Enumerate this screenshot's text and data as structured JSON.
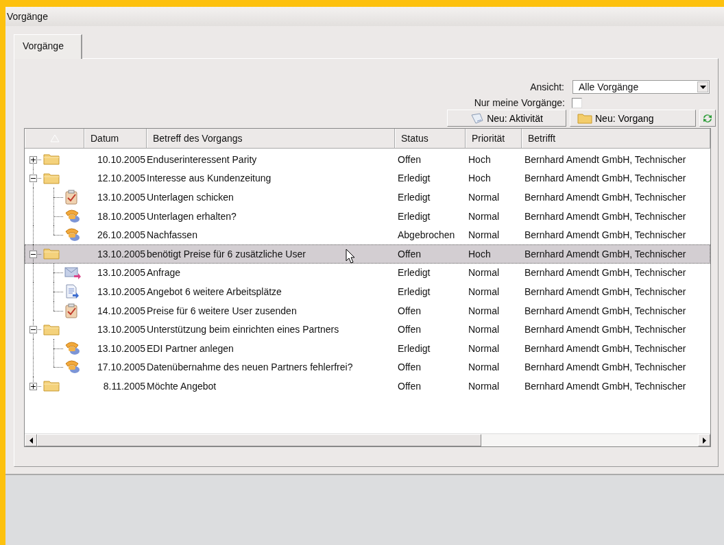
{
  "window": {
    "title": "Vorgänge"
  },
  "tabs": [
    {
      "label": "Vorgänge",
      "selected": true
    }
  ],
  "view": {
    "label": "Ansicht:",
    "value": "Alle Vorgänge"
  },
  "only_mine": {
    "label": "Nur meine Vorgänge:",
    "checked": false
  },
  "buttons": [
    {
      "label": "Neu: Aktivität",
      "kind": "activity"
    },
    {
      "label": "Neu: Vorgang",
      "kind": "folder"
    },
    {
      "kind": "refresh"
    }
  ],
  "table": {
    "columns": [
      "Datum",
      "Betreff des Vorgangs",
      "Status",
      "Priorität",
      "Betrifft"
    ],
    "rows": [
      {
        "kind": "folder",
        "date": "10.10.2005",
        "subject": "Enduserinteressent  Parity",
        "status": "Offen",
        "priority": "Hoch",
        "concerns": "Bernhard Amendt GmbH, Technischer",
        "expanded": false,
        "selected": false
      },
      {
        "kind": "folder",
        "date": "12.10.2005",
        "subject": "Interesse aus Kundenzeitung",
        "status": "Erledigt",
        "priority": "Hoch",
        "concerns": "Bernhard Amendt GmbH, Technischer",
        "expanded": true,
        "selected": false,
        "children": [
          {
            "kind": "task",
            "date": "13.10.2005",
            "subject": "Unterlagen schicken",
            "status": "Erledigt",
            "priority": "Normal",
            "concerns": "Bernhard Amendt GmbH, Technischer",
            "selected": false
          },
          {
            "kind": "call",
            "date": "18.10.2005",
            "subject": "Unterlagen erhalten?",
            "status": "Erledigt",
            "priority": "Normal",
            "concerns": "Bernhard Amendt GmbH, Technischer",
            "selected": false
          },
          {
            "kind": "call",
            "date": "26.10.2005",
            "subject": "Nachfassen",
            "status": "Abgebrochen",
            "priority": "Normal",
            "concerns": "Bernhard Amendt GmbH, Technischer",
            "selected": false
          }
        ]
      },
      {
        "kind": "folder",
        "date": "13.10.2005",
        "subject": "benötigt Preise für 6 zusätzliche User",
        "status": "Offen",
        "priority": "Hoch",
        "concerns": "Bernhard Amendt GmbH, Technischer",
        "expanded": true,
        "selected": true,
        "children": [
          {
            "kind": "email",
            "date": "13.10.2005",
            "subject": "Anfrage",
            "status": "Erledigt",
            "priority": "Normal",
            "concerns": "Bernhard Amendt GmbH, Technischer",
            "selected": false
          },
          {
            "kind": "document",
            "date": "13.10.2005",
            "subject": "Angebot 6 weitere Arbeitsplätze",
            "status": "Erledigt",
            "priority": "Normal",
            "concerns": "Bernhard Amendt GmbH, Technischer",
            "selected": false
          },
          {
            "kind": "task",
            "date": "14.10.2005",
            "subject": "Preise für 6 weitere User zusenden",
            "status": "Offen",
            "priority": "Normal",
            "concerns": "Bernhard Amendt GmbH, Technischer",
            "selected": false
          }
        ]
      },
      {
        "kind": "folder",
        "date": "13.10.2005",
        "subject": "Unterstützung beim einrichten eines Partners",
        "status": "Offen",
        "priority": "Normal",
        "concerns": "Bernhard Amendt GmbH, Technischer",
        "expanded": true,
        "selected": false,
        "children": [
          {
            "kind": "call",
            "date": "13.10.2005",
            "subject": "EDI Partner anlegen",
            "status": "Erledigt",
            "priority": "Normal",
            "concerns": "Bernhard Amendt GmbH, Technischer",
            "selected": false
          },
          {
            "kind": "call",
            "date": "17.10.2005",
            "subject": "Datenübernahme des neuen Partners fehlerfrei?",
            "status": "Offen",
            "priority": "Normal",
            "concerns": "Bernhard Amendt GmbH, Technischer",
            "selected": false
          }
        ]
      },
      {
        "kind": "folder",
        "date": "8.11.2005",
        "subject": "Möchte Angebot",
        "status": "Offen",
        "priority": "Normal",
        "concerns": "Bernhard Amendt GmbH, Technischer",
        "expanded": false,
        "selected": false
      }
    ]
  }
}
